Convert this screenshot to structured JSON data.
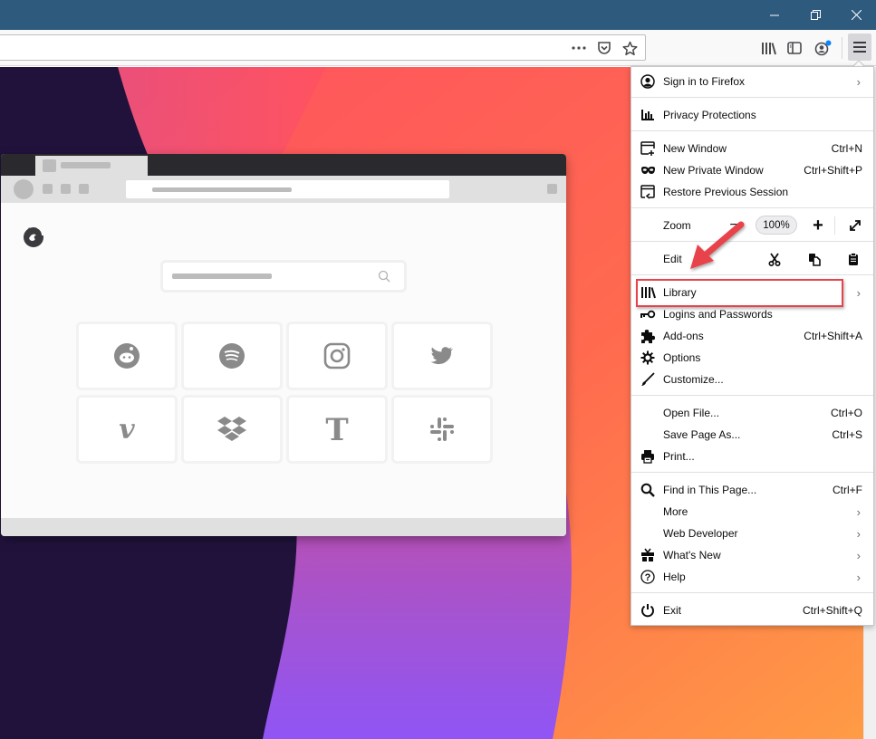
{
  "window": {
    "controls": [
      "minimize",
      "restore",
      "close"
    ]
  },
  "navbar": {
    "url_value": "",
    "url_actions": [
      "page-actions-icon",
      "pocket-icon",
      "bookmark-star-icon"
    ],
    "toolbar_icons": [
      "library-icon",
      "sidebar-icon",
      "account-icon",
      "hamburger-menu-icon"
    ],
    "account_badge_color": "#0a84ff"
  },
  "illustration": {
    "tiles": [
      "reddit",
      "spotify",
      "instagram",
      "twitter",
      "vimeo",
      "dropbox",
      "new-york-times",
      "slack"
    ]
  },
  "menu": {
    "sign_in": {
      "label": "Sign in to Firefox",
      "chevron": "›"
    },
    "privacy": {
      "label": "Privacy Protections"
    },
    "new_window": {
      "label": "New Window",
      "shortcut": "Ctrl+N"
    },
    "new_private": {
      "label": "New Private Window",
      "shortcut": "Ctrl+Shift+P"
    },
    "restore": {
      "label": "Restore Previous Session"
    },
    "zoom": {
      "label": "Zoom",
      "minus": "−",
      "value": "100%",
      "plus": "+"
    },
    "edit": {
      "label": "Edit"
    },
    "library": {
      "label": "Library",
      "chevron": "›"
    },
    "logins": {
      "label": "Logins and Passwords"
    },
    "addons": {
      "label": "Add-ons",
      "shortcut": "Ctrl+Shift+A"
    },
    "options": {
      "label": "Options"
    },
    "customize": {
      "label": "Customize..."
    },
    "open_file": {
      "label": "Open File...",
      "shortcut": "Ctrl+O"
    },
    "save_page": {
      "label": "Save Page As...",
      "shortcut": "Ctrl+S"
    },
    "print": {
      "label": "Print..."
    },
    "find": {
      "label": "Find in This Page...",
      "shortcut": "Ctrl+F"
    },
    "more": {
      "label": "More",
      "chevron": "›"
    },
    "web_dev": {
      "label": "Web Developer",
      "chevron": "›"
    },
    "whats_new": {
      "label": "What's New",
      "chevron": "›"
    },
    "help": {
      "label": "Help",
      "chevron": "›"
    },
    "exit": {
      "label": "Exit",
      "shortcut": "Ctrl+Shift+Q"
    }
  },
  "annotation": {
    "highlight_target": "Library",
    "color": "#e8434b"
  }
}
